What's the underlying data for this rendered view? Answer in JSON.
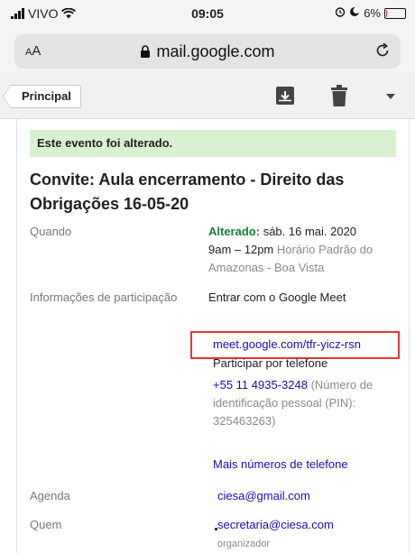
{
  "status_bar": {
    "carrier": "VIVO",
    "time": "09:05",
    "battery": "6%",
    "battery_level": 0.06,
    "battery_color": "#e53935"
  },
  "browser": {
    "text_size_label_small": "A",
    "text_size_label_large": "A",
    "url": "mail.google.com",
    "lock_icon": "lock-icon",
    "reload_icon": "reload-icon"
  },
  "toolbar": {
    "back_label": "Principal",
    "icons": [
      "archive-icon",
      "trash-icon",
      "chevron-down-icon"
    ]
  },
  "event": {
    "banner": "Este evento foi alterado.",
    "banner_color": "#d9f1d1",
    "title": "Convite: Aula encerramento - Direito das Obrigações 16-05-20",
    "when": {
      "label": "Quando",
      "changed_prefix": "Alterado:",
      "date": "sáb. 16 mai. 2020",
      "time_range": "9am – 12pm",
      "timezone": "Horário Padrão do Amazonas - Boa Vista"
    },
    "join": {
      "label": "Informações de participação",
      "meet_heading": "Entrar com o Google Meet",
      "meet_link": "meet.google.com/tfr-yicz-rsn",
      "highlight_color": "#e53935",
      "phone_heading": "Participar por telefone",
      "phone_number": "+55 11 4935-3248",
      "pin_text": "(Número de identificação pessoal (PIN): 325463263)",
      "more_numbers": "Mais números de telefone"
    },
    "calendar": {
      "label": "Agenda",
      "value": "ciesa@gmail.com"
    },
    "who": {
      "label": "Quem",
      "email": "secretaria@ciesa.com",
      "role": "organizador"
    }
  }
}
